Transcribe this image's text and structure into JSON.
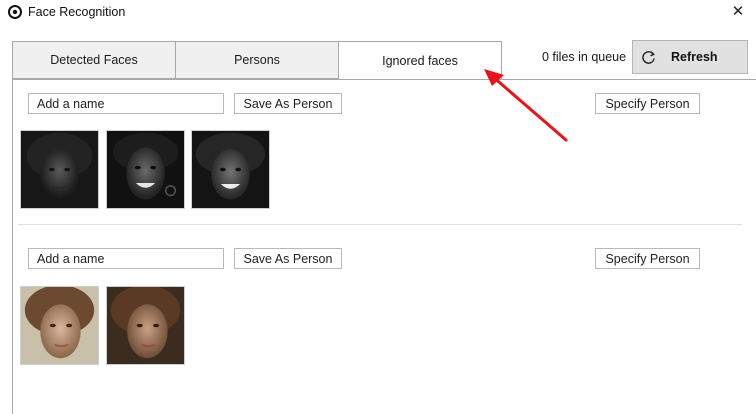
{
  "window": {
    "title": "Face Recognition",
    "close_glyph": "✕"
  },
  "tabs": [
    {
      "label": "Detected Faces",
      "active": false
    },
    {
      "label": "Persons",
      "active": false
    },
    {
      "label": "Ignored faces",
      "active": true
    }
  ],
  "header": {
    "queue_status": "0 files in queue",
    "refresh_label": "Refresh",
    "refresh_icon": "refresh-icon"
  },
  "groups": [
    {
      "name_placeholder": "Add a name",
      "save_label": "Save As Person",
      "specify_label": "Specify Person",
      "face_count": 3
    },
    {
      "name_placeholder": "Add a name",
      "save_label": "Save As Person",
      "specify_label": "Specify Person",
      "face_count": 2
    }
  ],
  "colors": {
    "arrow": "#e8141a",
    "tab_inactive": "#f0f0f0",
    "refresh_bg": "#e1e1e1"
  }
}
